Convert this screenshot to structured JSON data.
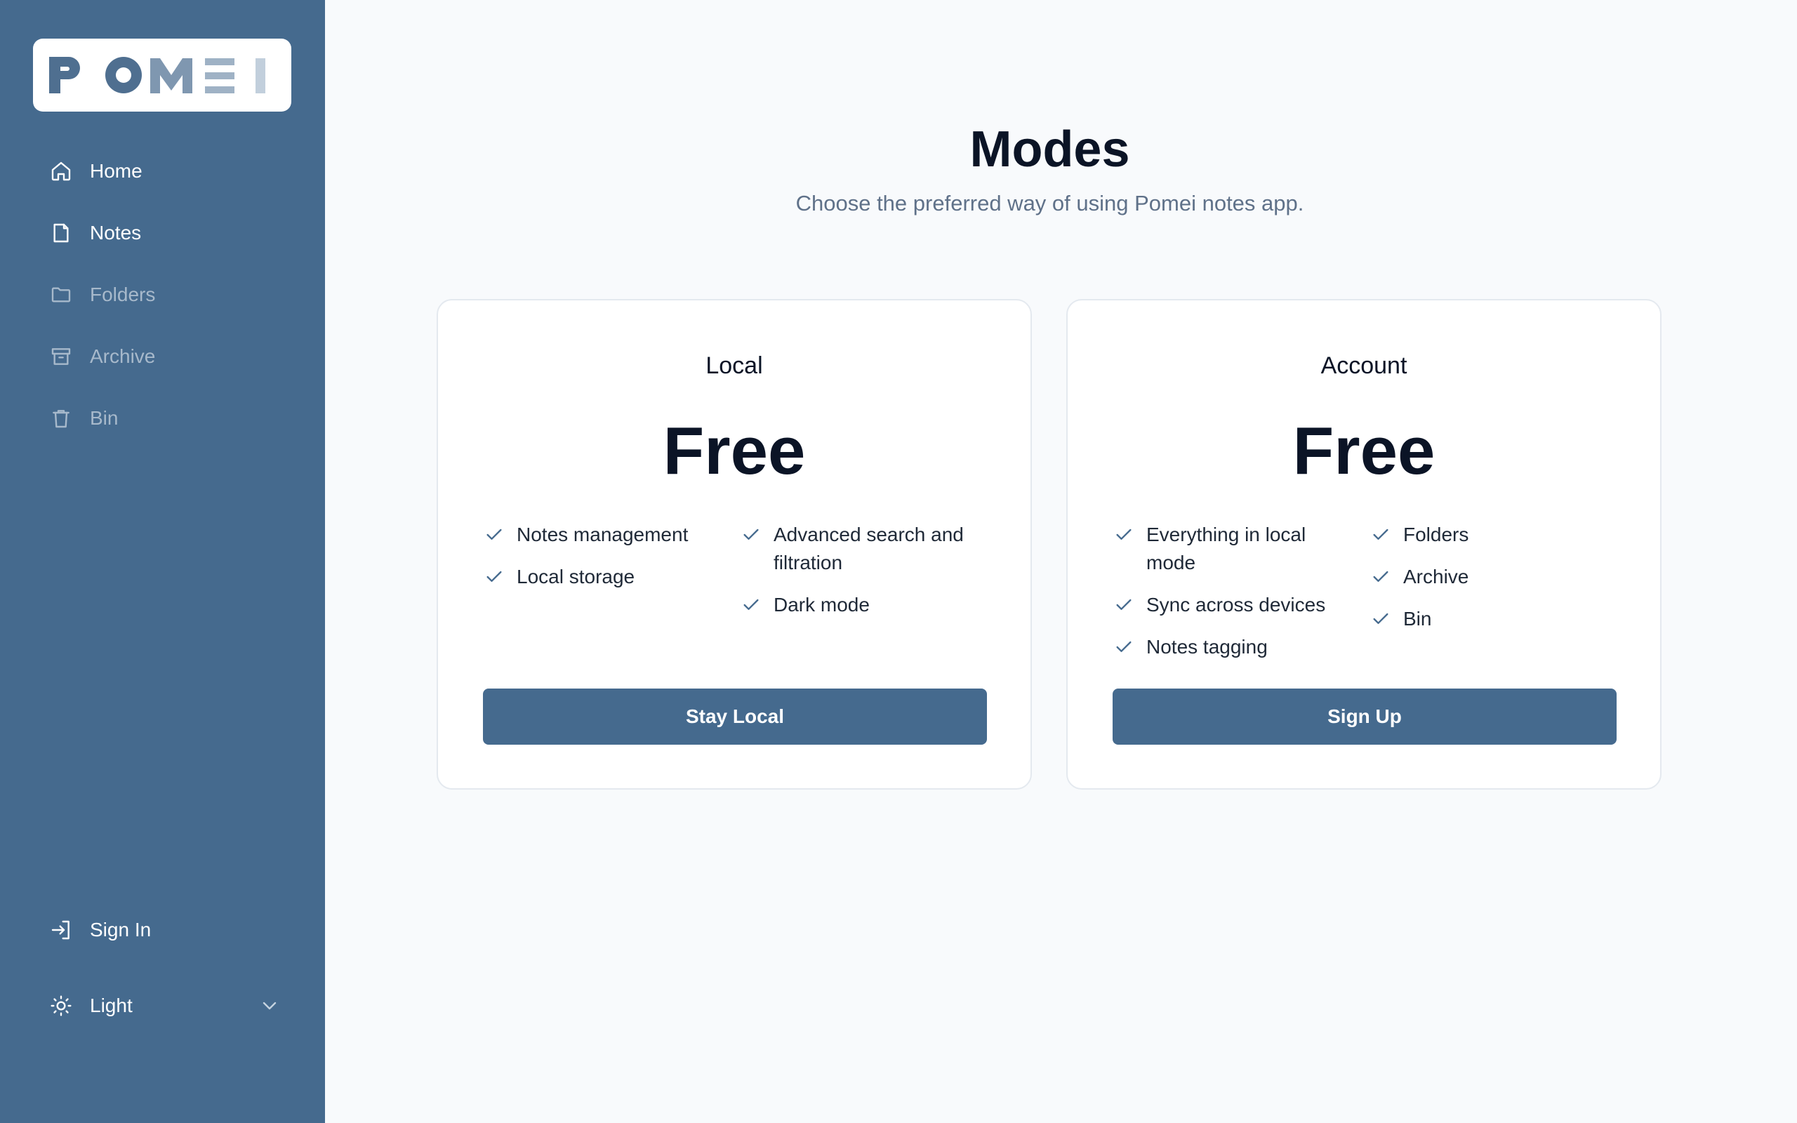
{
  "app": {
    "logo_text": "POMEI"
  },
  "sidebar": {
    "items": [
      {
        "label": "Home",
        "icon": "home-icon",
        "state": "active"
      },
      {
        "label": "Notes",
        "icon": "note-icon",
        "state": "active"
      },
      {
        "label": "Folders",
        "icon": "folder-icon",
        "state": "disabled"
      },
      {
        "label": "Archive",
        "icon": "archive-icon",
        "state": "disabled"
      },
      {
        "label": "Bin",
        "icon": "trash-icon",
        "state": "disabled"
      }
    ],
    "sign_in": {
      "label": "Sign In",
      "icon": "sign-in-icon"
    },
    "theme": {
      "value": "Light",
      "icon": "sun-icon",
      "options_icon": "chevron-down-icon"
    }
  },
  "main": {
    "title": "Modes",
    "subtitle": "Choose the preferred way of using Pomei notes app.",
    "cards": [
      {
        "title": "Local",
        "price": "Free",
        "features_col1": [
          "Notes management",
          "Local storage"
        ],
        "features_col2": [
          "Advanced search and filtration",
          "Dark mode"
        ],
        "button": "Stay Local"
      },
      {
        "title": "Account",
        "price": "Free",
        "features_col1": [
          "Everything in local mode",
          "Sync across devices",
          "Notes tagging"
        ],
        "features_col2": [
          "Folders",
          "Archive",
          "Bin"
        ],
        "button": "Sign Up"
      }
    ]
  },
  "colors": {
    "sidebar_bg": "#456a8e",
    "accent": "#456a8e",
    "page_bg": "#f8fafc",
    "muted_nav": "#a7b9cb"
  }
}
